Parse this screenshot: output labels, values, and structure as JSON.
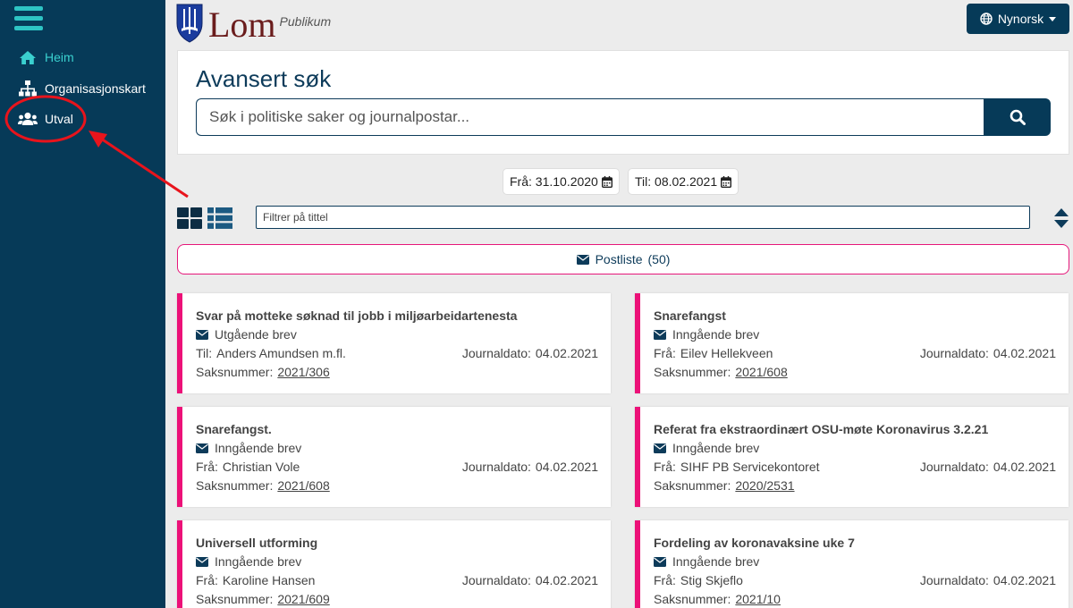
{
  "sidebar": {
    "items": [
      {
        "label": "Heim",
        "icon": "home-icon"
      },
      {
        "label": "Organisasjonskart",
        "icon": "sitemap-icon"
      },
      {
        "label": "Utval",
        "icon": "users-icon"
      }
    ]
  },
  "header": {
    "logo_text": "Lom",
    "logo_sub": "Publikum",
    "language": "Nynorsk"
  },
  "search": {
    "title": "Avansert søk",
    "placeholder": "Søk i politiske saker og journalpostar..."
  },
  "dates": {
    "from": "Frå: 31.10.2020",
    "to": "Til: 08.02.2021"
  },
  "filter": {
    "placeholder": "Filtrer på tittel"
  },
  "postliste": {
    "label": "Postliste",
    "count": "(50)"
  },
  "labels": {
    "journaldato": "Journaldato:",
    "saksnummer": "Saksnummer:"
  },
  "cards": [
    {
      "title": "Svar på motteke søknad til jobb i miljøarbeidartenesta",
      "type": "Utgående brev",
      "party_label": "Til:",
      "party": "Anders Amundsen m.fl.",
      "date": "04.02.2021",
      "saksnr": "2021/306"
    },
    {
      "title": "Snarefangst",
      "type": "Inngående brev",
      "party_label": "Frå:",
      "party": "Eilev Hellekveen",
      "date": "04.02.2021",
      "saksnr": "2021/608"
    },
    {
      "title": "Snarefangst.",
      "type": "Inngående brev",
      "party_label": "Frå:",
      "party": "Christian Vole",
      "date": "04.02.2021",
      "saksnr": "2021/608"
    },
    {
      "title": "Referat fra ekstraordinært OSU-møte Koronavirus 3.2.21",
      "type": "Inngående brev",
      "party_label": "Frå:",
      "party": "SIHF PB Servicekontoret",
      "date": "04.02.2021",
      "saksnr": "2020/2531"
    },
    {
      "title": "Universell utforming",
      "type": "Inngående brev",
      "party_label": "Frå:",
      "party": "Karoline Hansen",
      "date": "04.02.2021",
      "saksnr": "2021/609"
    },
    {
      "title": "Fordeling av koronavaksine uke 7",
      "type": "Inngående brev",
      "party_label": "Frå:",
      "party": "Stig Skjeflo",
      "date": "04.02.2021",
      "saksnr": "2021/10"
    }
  ],
  "colors": {
    "sidebar": "#063a58",
    "accent_teal": "#3ad0cf",
    "card_accent": "#ec1178",
    "annotation": "#e8141c"
  }
}
